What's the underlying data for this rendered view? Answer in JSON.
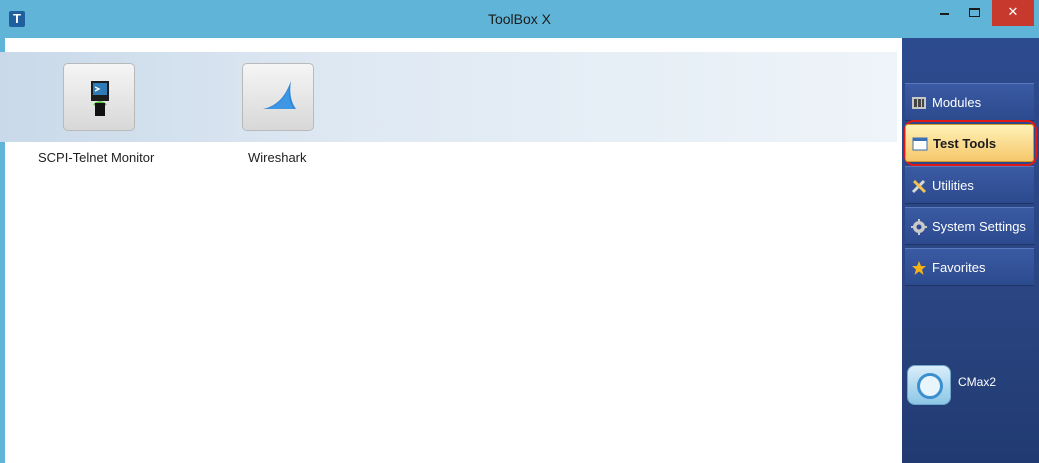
{
  "window": {
    "title": "ToolBox X",
    "app_icon_letter": "T",
    "close_glyph": "✕"
  },
  "tools": [
    {
      "label": "SCPI-Telnet Monitor",
      "icon": "scpi-telnet-monitor-icon"
    },
    {
      "label": "Wireshark",
      "icon": "wireshark-shark-fin-icon"
    }
  ],
  "sidebar": {
    "items": [
      {
        "label": "Modules",
        "icon": "modules-icon"
      },
      {
        "label": "Test Tools",
        "icon": "test-tools-icon",
        "selected": true
      },
      {
        "label": "Utilities",
        "icon": "utilities-tools-icon"
      },
      {
        "label": "System Settings",
        "icon": "gear-icon"
      },
      {
        "label": "Favorites",
        "icon": "star-icon"
      }
    ],
    "device": {
      "label": "CMax2",
      "icon": "cmax2-device-icon"
    }
  },
  "colors": {
    "titlebar": "#5fb4d8",
    "sidebar": "#2c4a8e",
    "selected_item": "#f6c76a",
    "highlight_ring": "#e01818",
    "close_button": "#c7392c"
  }
}
